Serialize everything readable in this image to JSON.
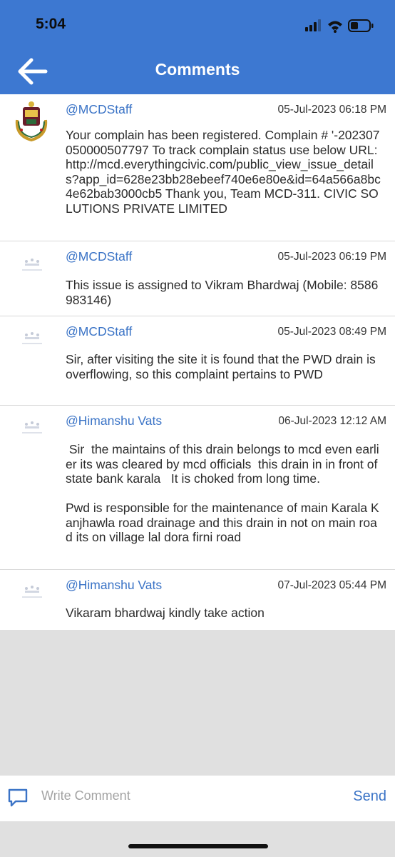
{
  "status": {
    "time": "5:04"
  },
  "header": {
    "title": "Comments"
  },
  "comments": [
    {
      "author": "@MCDStaff",
      "date": "05-Jul-2023 06:18 PM",
      "text": "Your complain has been registered. Complain # '-202307050000507797 To track complain status use below URL: http://mcd.everythingcivic.com/public_view_issue_details?app_id=628e23bb28ebeef740e6e80e&id=64a566a8bc4e62bab3000cb5 Thank you, Team MCD-311. CIVIC SOLUTIONS PRIVATE LIMITED",
      "avatar": "mcd-logo"
    },
    {
      "author": "@MCDStaff",
      "date": "05-Jul-2023 06:19 PM",
      "text": "This issue is assigned to Vikram Bhardwaj (Mobile: 8586983146)",
      "avatar": "faint-logo"
    },
    {
      "author": "@MCDStaff",
      "date": "05-Jul-2023 08:49 PM",
      "text": "Sir, after visiting the site it is found that the PWD drain is overflowing, so this complaint pertains to PWD",
      "avatar": "faint-logo"
    },
    {
      "author": "@Himanshu Vats",
      "date": "06-Jul-2023 12:12 AM",
      "text": " Sir  the maintains of this drain belongs to mcd even earlier its was cleared by mcd officials  this drain in in front of state bank karala   It is choked from long time.\n\nPwd is responsible for the maintenance of main Karala Kanjhawla road drainage and this drain in not on main road its on village lal dora firni road",
      "avatar": "faint-logo"
    },
    {
      "author": "@Himanshu Vats",
      "date": "07-Jul-2023 05:44 PM",
      "text": "Vikaram bhardwaj kindly take action",
      "avatar": "faint-logo"
    }
  ],
  "composer": {
    "placeholder": "Write Comment",
    "send_label": "Send"
  },
  "colors": {
    "accent": "#3d78d1",
    "link": "#3a73c6",
    "background_empty": "#e0e0e0"
  }
}
